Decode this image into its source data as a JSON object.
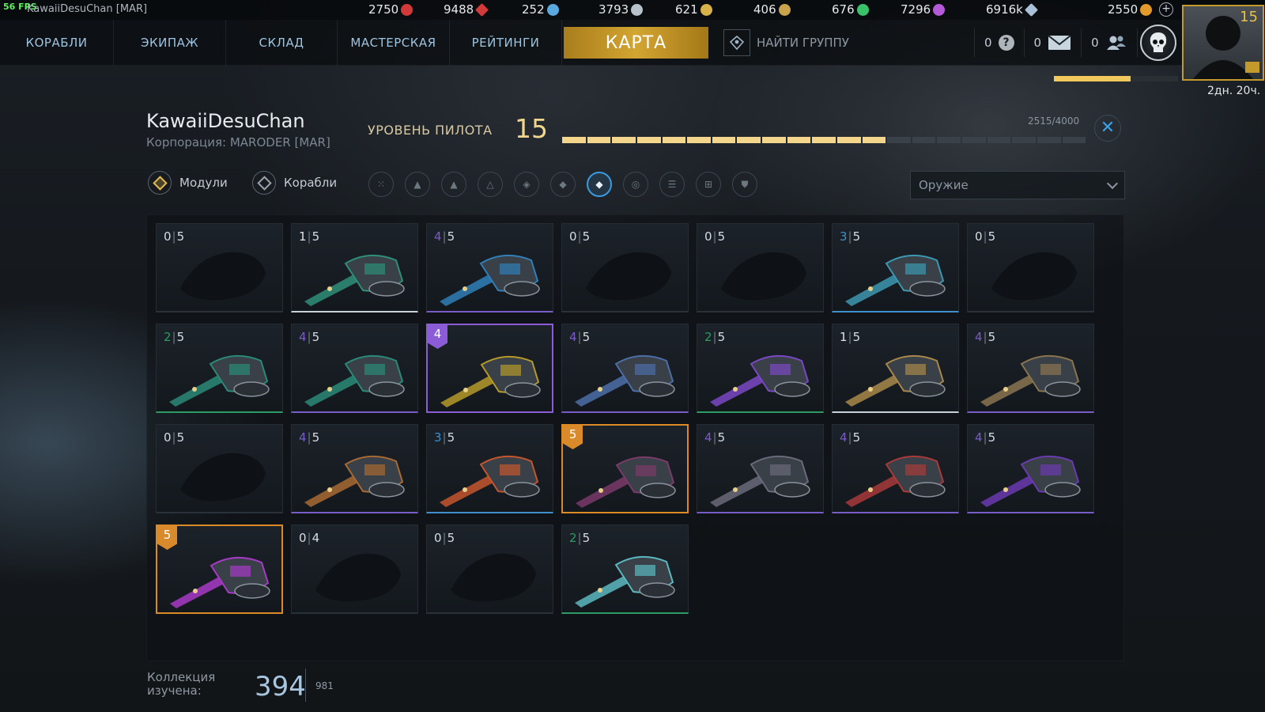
{
  "top_bar": {
    "fps": "56 FPS",
    "player_tag": "KawaiiDesuChan [MAR]",
    "resources": [
      {
        "value": "2750",
        "icon": "red-shield-icon",
        "color": "#d23a3a"
      },
      {
        "value": "9488",
        "icon": "red-cube-icon",
        "color": "#d23a3a"
      },
      {
        "value": "252",
        "icon": "blue-orb-icon",
        "color": "#5aa8e0"
      },
      {
        "value": "3793",
        "icon": "silver-orb-icon",
        "color": "#b8c2cc"
      },
      {
        "value": "621",
        "icon": "gold-wings-icon",
        "color": "#d7b14a"
      },
      {
        "value": "406",
        "icon": "gold-wings-icon",
        "color": "#c9a44a"
      },
      {
        "value": "676",
        "icon": "green-leaf-icon",
        "color": "#3ac26a"
      },
      {
        "value": "7296",
        "icon": "purple-orb-icon",
        "color": "#b45ad8"
      },
      {
        "value": "6916k",
        "icon": "credits-icon",
        "color": "#a9c0d8"
      },
      {
        "value": "2550",
        "icon": "gold-coin-icon",
        "color": "#e29a2a"
      }
    ]
  },
  "nav": {
    "items": [
      "КОРАБЛИ",
      "ЭКИПАЖ",
      "СКЛАД",
      "МАСТЕРСКАЯ",
      "РЕЙТИНГИ"
    ],
    "map_label": "КАРТА",
    "find_group": "НАЙТИ ГРУППУ",
    "counters": [
      {
        "value": "0",
        "icon": "question-icon"
      },
      {
        "value": "0",
        "icon": "mail-icon"
      },
      {
        "value": "0",
        "icon": "friends-icon"
      }
    ],
    "avatar_level": "15",
    "timer": "2дн. 20ч.",
    "bonus_progress": 0.62
  },
  "pilot": {
    "name": "KawaiiDesuChan",
    "corporation": "Корпорация: MARODER [MAR]",
    "level_label": "УРОВЕНЬ ПИЛОТА",
    "level": "15",
    "xp_text": "2515/4000",
    "xp_current": 2515,
    "xp_max": 4000,
    "xp_segments": 21
  },
  "filters": {
    "modules_label": "Модули",
    "ships_label": "Корабли",
    "icons": [
      {
        "name": "all-filter-icon",
        "glyph": "⁙",
        "active": false
      },
      {
        "name": "interceptor-filter-icon",
        "glyph": "▲",
        "active": false
      },
      {
        "name": "fighter-filter-icon",
        "glyph": "▲",
        "active": false
      },
      {
        "name": "frigate-filter-icon",
        "glyph": "△",
        "active": false
      },
      {
        "name": "engine-filter-icon",
        "glyph": "◈",
        "active": false
      },
      {
        "name": "hull-filter-icon",
        "glyph": "◆",
        "active": false
      },
      {
        "name": "weapon-filter-icon",
        "glyph": "◆",
        "active": true
      },
      {
        "name": "sensor-filter-icon",
        "glyph": "◎",
        "active": false
      },
      {
        "name": "capacitor-filter-icon",
        "glyph": "☰",
        "active": false
      },
      {
        "name": "special-filter-icon",
        "glyph": "⊞",
        "active": false
      },
      {
        "name": "shield-filter-icon",
        "glyph": "⛊",
        "active": false
      }
    ],
    "dropdown_value": "Оружие"
  },
  "modules": [
    {
      "count": "0",
      "max": "5",
      "owned": false,
      "accent": "#2a3138"
    },
    {
      "count": "1",
      "max": "5",
      "owned": true,
      "accent": "#c9d1d8",
      "color": "#2e8f78"
    },
    {
      "count": "4",
      "max": "5",
      "owned": true,
      "accent": "#7a5cc8",
      "color": "#2f7fb8"
    },
    {
      "count": "0",
      "max": "5",
      "owned": false,
      "accent": "#2a3138"
    },
    {
      "count": "0",
      "max": "5",
      "owned": false,
      "accent": "#2a3138"
    },
    {
      "count": "3",
      "max": "5",
      "owned": true,
      "accent": "#3f8fcc",
      "color": "#3c97b0"
    },
    {
      "count": "0",
      "max": "5",
      "owned": false,
      "accent": "#2a3138"
    },
    {
      "count": "2",
      "max": "5",
      "owned": true,
      "accent": "#2e9a64",
      "color": "#2a8a78"
    },
    {
      "count": "4",
      "max": "5",
      "owned": true,
      "accent": "#7a5cc8",
      "color": "#2a8a78"
    },
    {
      "count": "",
      "max": "",
      "owned": true,
      "accent": "#8b5cd6",
      "color": "#b59a2a",
      "badge": "4",
      "badge_color": "#8b5cd6",
      "selected": "purple"
    },
    {
      "count": "4",
      "max": "5",
      "owned": true,
      "accent": "#7a5cc8",
      "color": "#4c6ea8"
    },
    {
      "count": "2",
      "max": "5",
      "owned": true,
      "accent": "#2e9a64",
      "color": "#7a48c4"
    },
    {
      "count": "1",
      "max": "5",
      "owned": true,
      "accent": "#c9d1d8",
      "color": "#a8884a"
    },
    {
      "count": "4",
      "max": "5",
      "owned": true,
      "accent": "#7a5cc8",
      "color": "#8a7450"
    },
    {
      "count": "0",
      "max": "5",
      "owned": false,
      "accent": "#2a3138"
    },
    {
      "count": "4",
      "max": "5",
      "owned": true,
      "accent": "#7a5cc8",
      "color": "#a86a32"
    },
    {
      "count": "3",
      "max": "5",
      "owned": true,
      "accent": "#3f8fcc",
      "color": "#c4562e"
    },
    {
      "count": "",
      "max": "",
      "owned": true,
      "accent": "#dc8a26",
      "color": "#7a3a6a",
      "badge": "5",
      "badge_color": "#d98a2a",
      "selected": "orange"
    },
    {
      "count": "4",
      "max": "5",
      "owned": true,
      "accent": "#7a5cc8",
      "color": "#6a6a7a"
    },
    {
      "count": "4",
      "max": "5",
      "owned": true,
      "accent": "#7a5cc8",
      "color": "#a83a3a"
    },
    {
      "count": "4",
      "max": "5",
      "owned": true,
      "accent": "#7a5cc8",
      "color": "#6a3ab0"
    },
    {
      "count": "",
      "max": "",
      "owned": true,
      "accent": "#dc8a26",
      "color": "#a83ac8",
      "badge": "5",
      "badge_color": "#d98a2a",
      "selected": "orange"
    },
    {
      "count": "0",
      "max": "4",
      "owned": false,
      "accent": "#2a3138"
    },
    {
      "count": "0",
      "max": "5",
      "owned": false,
      "accent": "#2a3138"
    },
    {
      "count": "2",
      "max": "5",
      "owned": true,
      "accent": "#2e9a64",
      "color": "#5ab8c0"
    }
  ],
  "collection": {
    "label": "Коллекция изучена:",
    "value": "394",
    "total": "981"
  }
}
